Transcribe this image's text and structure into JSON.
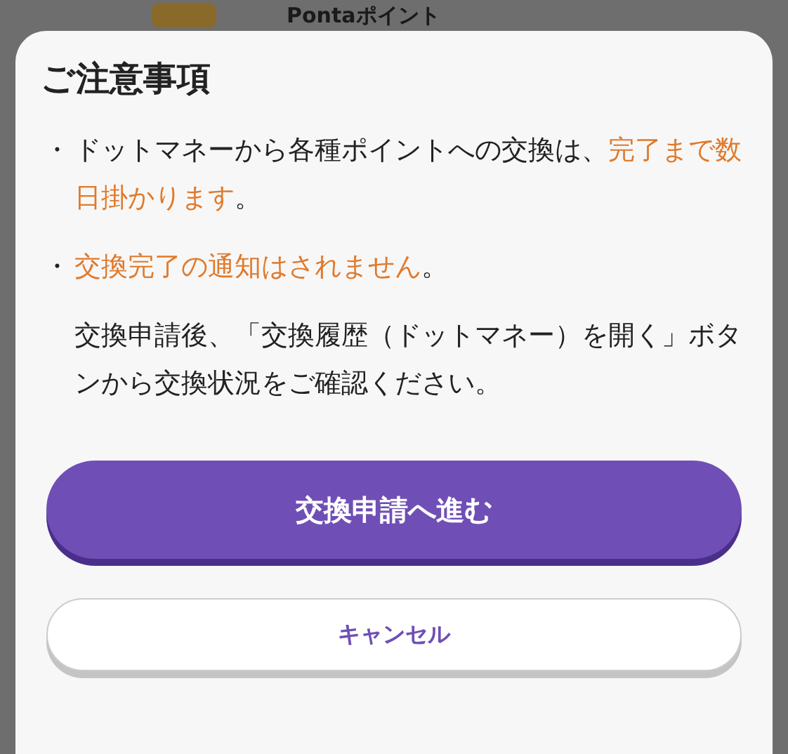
{
  "background": {
    "label": "Pontaポイント"
  },
  "dialog": {
    "title": "ご注意事項",
    "items": [
      {
        "kind": "bullet",
        "bullet": "・",
        "segments": [
          {
            "text": "ドットマネーから各種ポイントへの交換は、",
            "highlight": false
          },
          {
            "text": "完了まで数日掛かります",
            "highlight": true
          },
          {
            "text": "。",
            "highlight": false
          }
        ]
      },
      {
        "kind": "bullet",
        "bullet": "・",
        "segments": [
          {
            "text": "交換完了の通知はされません",
            "highlight": true
          },
          {
            "text": "。",
            "highlight": false
          }
        ]
      },
      {
        "kind": "note",
        "segments": [
          {
            "text": "交換申請後、「交換履歴（ドットマネー）を開く」ボタンから交換状況をご確認ください。",
            "highlight": false
          }
        ]
      }
    ],
    "buttons": [
      {
        "kind": "primary",
        "label": "交換申請へ進む"
      },
      {
        "kind": "secondary",
        "label": "キャンセル"
      }
    ]
  }
}
